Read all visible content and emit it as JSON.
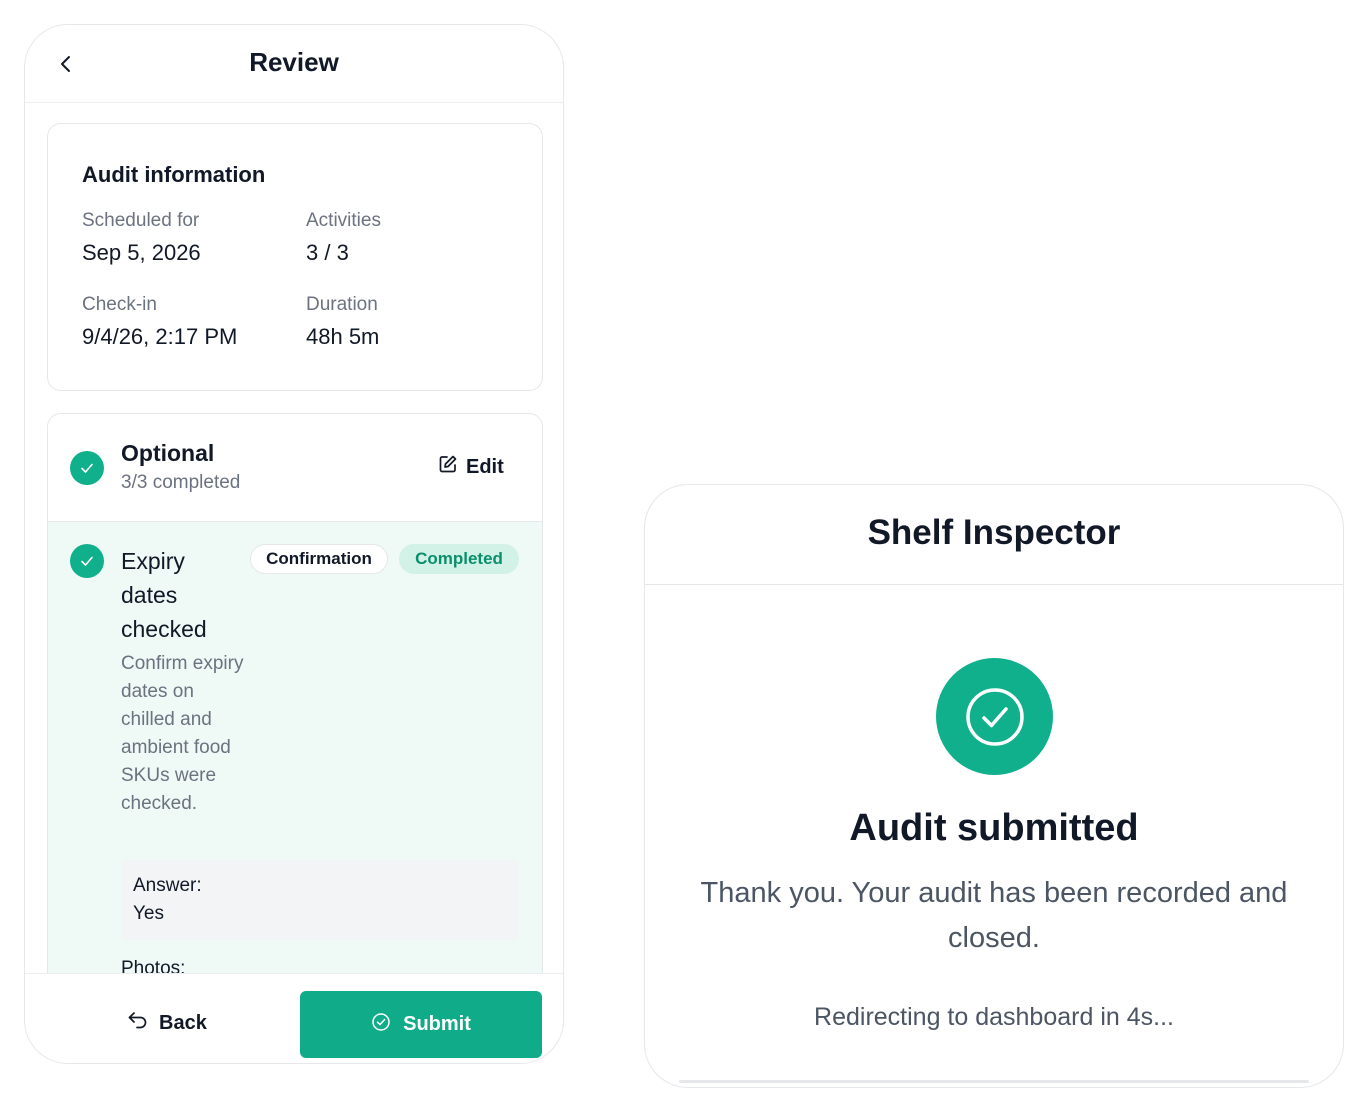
{
  "review": {
    "title": "Review",
    "audit_info": {
      "heading": "Audit information",
      "scheduled_label": "Scheduled for",
      "scheduled_value": "Sep 5, 2026",
      "activities_label": "Activities",
      "activities_value": "3 / 3",
      "checkin_label": "Check-in",
      "checkin_value": "9/4/26, 2:17 PM",
      "duration_label": "Duration",
      "duration_value": "48h 5m"
    },
    "section": {
      "title": "Optional",
      "subtitle": "3/3 completed",
      "edit_label": "Edit"
    },
    "activity": {
      "title": "Expiry dates checked",
      "type_badge": "Confirmation",
      "status_badge": "Completed",
      "description": "Confirm expiry dates on chilled and ambient food SKUs were checked.",
      "answer_label": "Answer:",
      "answer_value": "Yes",
      "photos_label": "Photos:"
    },
    "footer": {
      "back_label": "Back",
      "submit_label": "Submit"
    }
  },
  "confirmation": {
    "title": "Shelf Inspector",
    "heading": "Audit submitted",
    "message": "Thank you. Your audit has been recorded and closed.",
    "redirect": "Redirecting to dashboard in 4s..."
  },
  "colors": {
    "accent": "#10b08c",
    "accent_soft": "#eff9f6",
    "badge_completed_bg": "#d2f1e7",
    "badge_completed_text": "#0a8f6d"
  },
  "icons": {
    "back": "chevron-left-icon",
    "check": "check-icon",
    "edit": "pencil-square-icon",
    "undo": "undo-arrow-icon",
    "submit": "check-circle-icon",
    "success": "check-circle-icon"
  }
}
